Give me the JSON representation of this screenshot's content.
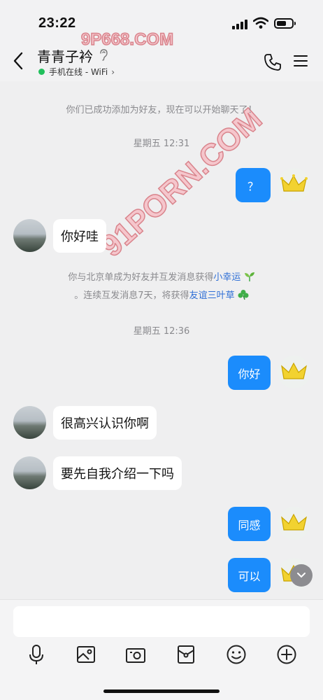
{
  "status_bar": {
    "time": "23:22"
  },
  "header": {
    "contact_name": "青青子衿",
    "online_status": "手机在线 - WiFi",
    "online_chevron": "›"
  },
  "watermarks": [
    "9P668.COM",
    "91PORN.COM"
  ],
  "messages": {
    "system_added": "你们已成功添加为好友，现在可以开始聊天了！",
    "ts1": "星期五 12:31",
    "r1": "？",
    "l1": "你好哇",
    "sys2_line1_prefix": "你与北京单成为好友并互发消息获得",
    "sys2_line1_link": "小幸运",
    "sys2_line2_prefix": "。连续互发消息7天，将获得",
    "sys2_line2_link": "友谊三叶草",
    "ts2": "星期五 12:36",
    "r2": "你好",
    "l2": "很高兴认识你啊",
    "l3": "要先自我介绍一下吗",
    "r3": "同感",
    "r4": "可以"
  },
  "toolbar": {
    "icons": [
      "microphone-icon",
      "image-icon",
      "camera-icon",
      "red-envelope-icon",
      "emoji-icon",
      "plus-icon"
    ]
  },
  "colors": {
    "bubble_self": "#1b8cfc",
    "online_dot": "#21c05c",
    "link": "#2f6fd6"
  }
}
